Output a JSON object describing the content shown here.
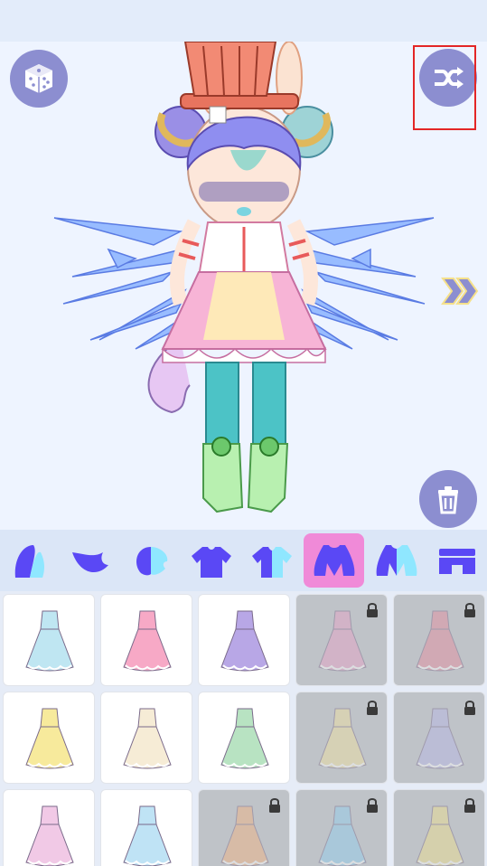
{
  "stage": {
    "icons": [
      "dice-icon",
      "shuffle-icon",
      "double-chevron-right-icon",
      "trash-icon"
    ]
  },
  "colors": {
    "button": "#8c8ed0",
    "tab_icon": "#5a48f5",
    "tab_active_bg": "#f08ad8",
    "highlight": "#e32626",
    "locked_cell": "#bfc3c8"
  },
  "tabs": [
    {
      "icon": "hair-back-icon",
      "active": false
    },
    {
      "icon": "hair-front-icon",
      "active": false
    },
    {
      "icon": "hair-side-icon",
      "active": false
    },
    {
      "icon": "shirt-icon",
      "active": false
    },
    {
      "icon": "shirt-two-tone-icon",
      "active": false
    },
    {
      "icon": "dress-icon",
      "active": true
    },
    {
      "icon": "dress-two-tone-icon",
      "active": false
    },
    {
      "icon": "skirt-icon",
      "active": false
    }
  ],
  "items": [
    {
      "color": "#bfe6f2",
      "locked": false
    },
    {
      "color": "#f7a9c6",
      "locked": false
    },
    {
      "color": "#b8a7e6",
      "locked": false
    },
    {
      "color": "#e9a0c6",
      "locked": true
    },
    {
      "color": "#e88b9c",
      "locked": true
    },
    {
      "color": "#f7ea9c",
      "locked": false
    },
    {
      "color": "#f6ecd6",
      "locked": false
    },
    {
      "color": "#b8e3c2",
      "locked": false
    },
    {
      "color": "#f3e3a0",
      "locked": true
    },
    {
      "color": "#b8b6e8",
      "locked": true
    },
    {
      "color": "#f1c9e6",
      "locked": false
    },
    {
      "color": "#bfe3f5",
      "locked": false
    },
    {
      "color": "#f5b27e",
      "locked": true
    },
    {
      "color": "#8fd0f0",
      "locked": true
    },
    {
      "color": "#f0e08c",
      "locked": true
    }
  ]
}
